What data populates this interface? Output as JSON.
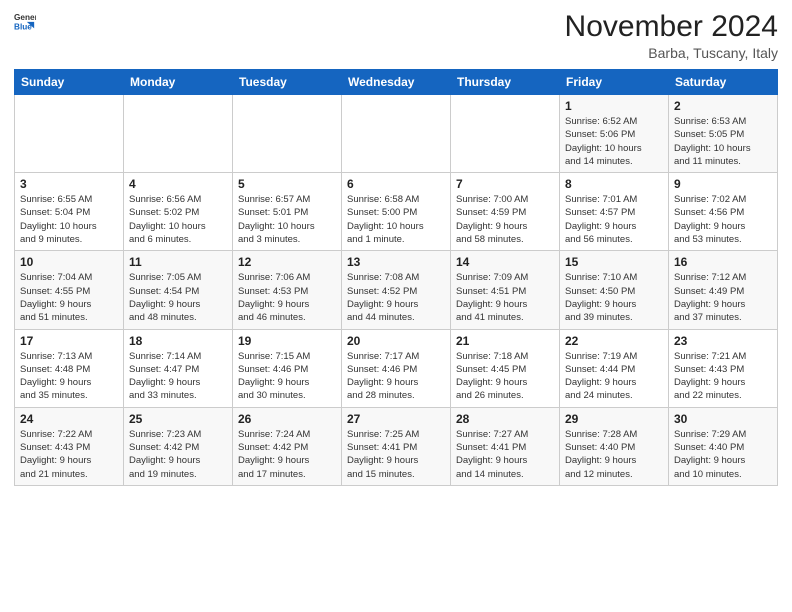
{
  "header": {
    "logo": {
      "line1": "General",
      "line2": "Blue"
    },
    "month": "November 2024",
    "location": "Barba, Tuscany, Italy"
  },
  "weekdays": [
    "Sunday",
    "Monday",
    "Tuesday",
    "Wednesday",
    "Thursday",
    "Friday",
    "Saturday"
  ],
  "weeks": [
    [
      {
        "day": "",
        "info": ""
      },
      {
        "day": "",
        "info": ""
      },
      {
        "day": "",
        "info": ""
      },
      {
        "day": "",
        "info": ""
      },
      {
        "day": "",
        "info": ""
      },
      {
        "day": "1",
        "info": "Sunrise: 6:52 AM\nSunset: 5:06 PM\nDaylight: 10 hours\nand 14 minutes."
      },
      {
        "day": "2",
        "info": "Sunrise: 6:53 AM\nSunset: 5:05 PM\nDaylight: 10 hours\nand 11 minutes."
      }
    ],
    [
      {
        "day": "3",
        "info": "Sunrise: 6:55 AM\nSunset: 5:04 PM\nDaylight: 10 hours\nand 9 minutes."
      },
      {
        "day": "4",
        "info": "Sunrise: 6:56 AM\nSunset: 5:02 PM\nDaylight: 10 hours\nand 6 minutes."
      },
      {
        "day": "5",
        "info": "Sunrise: 6:57 AM\nSunset: 5:01 PM\nDaylight: 10 hours\nand 3 minutes."
      },
      {
        "day": "6",
        "info": "Sunrise: 6:58 AM\nSunset: 5:00 PM\nDaylight: 10 hours\nand 1 minute."
      },
      {
        "day": "7",
        "info": "Sunrise: 7:00 AM\nSunset: 4:59 PM\nDaylight: 9 hours\nand 58 minutes."
      },
      {
        "day": "8",
        "info": "Sunrise: 7:01 AM\nSunset: 4:57 PM\nDaylight: 9 hours\nand 56 minutes."
      },
      {
        "day": "9",
        "info": "Sunrise: 7:02 AM\nSunset: 4:56 PM\nDaylight: 9 hours\nand 53 minutes."
      }
    ],
    [
      {
        "day": "10",
        "info": "Sunrise: 7:04 AM\nSunset: 4:55 PM\nDaylight: 9 hours\nand 51 minutes."
      },
      {
        "day": "11",
        "info": "Sunrise: 7:05 AM\nSunset: 4:54 PM\nDaylight: 9 hours\nand 48 minutes."
      },
      {
        "day": "12",
        "info": "Sunrise: 7:06 AM\nSunset: 4:53 PM\nDaylight: 9 hours\nand 46 minutes."
      },
      {
        "day": "13",
        "info": "Sunrise: 7:08 AM\nSunset: 4:52 PM\nDaylight: 9 hours\nand 44 minutes."
      },
      {
        "day": "14",
        "info": "Sunrise: 7:09 AM\nSunset: 4:51 PM\nDaylight: 9 hours\nand 41 minutes."
      },
      {
        "day": "15",
        "info": "Sunrise: 7:10 AM\nSunset: 4:50 PM\nDaylight: 9 hours\nand 39 minutes."
      },
      {
        "day": "16",
        "info": "Sunrise: 7:12 AM\nSunset: 4:49 PM\nDaylight: 9 hours\nand 37 minutes."
      }
    ],
    [
      {
        "day": "17",
        "info": "Sunrise: 7:13 AM\nSunset: 4:48 PM\nDaylight: 9 hours\nand 35 minutes."
      },
      {
        "day": "18",
        "info": "Sunrise: 7:14 AM\nSunset: 4:47 PM\nDaylight: 9 hours\nand 33 minutes."
      },
      {
        "day": "19",
        "info": "Sunrise: 7:15 AM\nSunset: 4:46 PM\nDaylight: 9 hours\nand 30 minutes."
      },
      {
        "day": "20",
        "info": "Sunrise: 7:17 AM\nSunset: 4:46 PM\nDaylight: 9 hours\nand 28 minutes."
      },
      {
        "day": "21",
        "info": "Sunrise: 7:18 AM\nSunset: 4:45 PM\nDaylight: 9 hours\nand 26 minutes."
      },
      {
        "day": "22",
        "info": "Sunrise: 7:19 AM\nSunset: 4:44 PM\nDaylight: 9 hours\nand 24 minutes."
      },
      {
        "day": "23",
        "info": "Sunrise: 7:21 AM\nSunset: 4:43 PM\nDaylight: 9 hours\nand 22 minutes."
      }
    ],
    [
      {
        "day": "24",
        "info": "Sunrise: 7:22 AM\nSunset: 4:43 PM\nDaylight: 9 hours\nand 21 minutes."
      },
      {
        "day": "25",
        "info": "Sunrise: 7:23 AM\nSunset: 4:42 PM\nDaylight: 9 hours\nand 19 minutes."
      },
      {
        "day": "26",
        "info": "Sunrise: 7:24 AM\nSunset: 4:42 PM\nDaylight: 9 hours\nand 17 minutes."
      },
      {
        "day": "27",
        "info": "Sunrise: 7:25 AM\nSunset: 4:41 PM\nDaylight: 9 hours\nand 15 minutes."
      },
      {
        "day": "28",
        "info": "Sunrise: 7:27 AM\nSunset: 4:41 PM\nDaylight: 9 hours\nand 14 minutes."
      },
      {
        "day": "29",
        "info": "Sunrise: 7:28 AM\nSunset: 4:40 PM\nDaylight: 9 hours\nand 12 minutes."
      },
      {
        "day": "30",
        "info": "Sunrise: 7:29 AM\nSunset: 4:40 PM\nDaylight: 9 hours\nand 10 minutes."
      }
    ]
  ]
}
